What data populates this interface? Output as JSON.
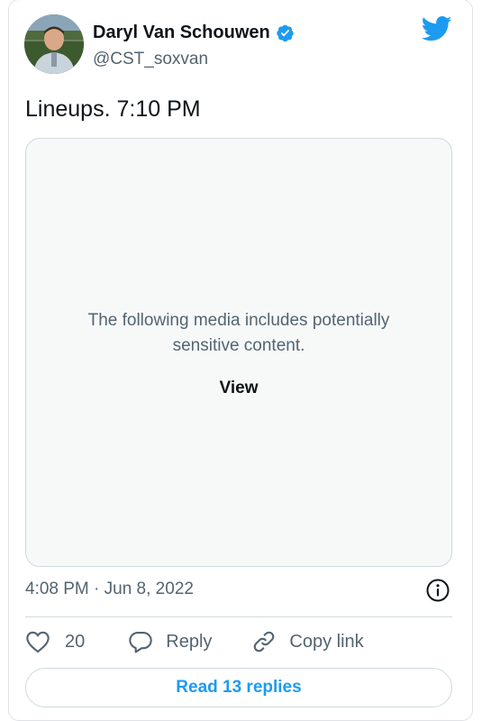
{
  "author": {
    "name": "Daryl Van Schouwen",
    "handle": "@CST_soxvan",
    "verified": true
  },
  "tweet": {
    "text": "Lineups. 7:10 PM",
    "timestamp": "4:08 PM · Jun 8, 2022"
  },
  "media": {
    "notice": "The following media includes potentially sensitive content.",
    "view_label": "View"
  },
  "actions": {
    "like_count": "20",
    "reply_label": "Reply",
    "copy_link_label": "Copy link"
  },
  "read_replies_label": "Read 13 replies",
  "colors": {
    "twitter_blue": "#1d9bf0",
    "text_primary": "#0f1419",
    "text_secondary": "#536471",
    "border": "#cfd9de"
  },
  "icons": [
    "twitter-bird-icon",
    "verified-badge-icon",
    "info-icon",
    "heart-icon",
    "reply-icon",
    "link-icon"
  ]
}
